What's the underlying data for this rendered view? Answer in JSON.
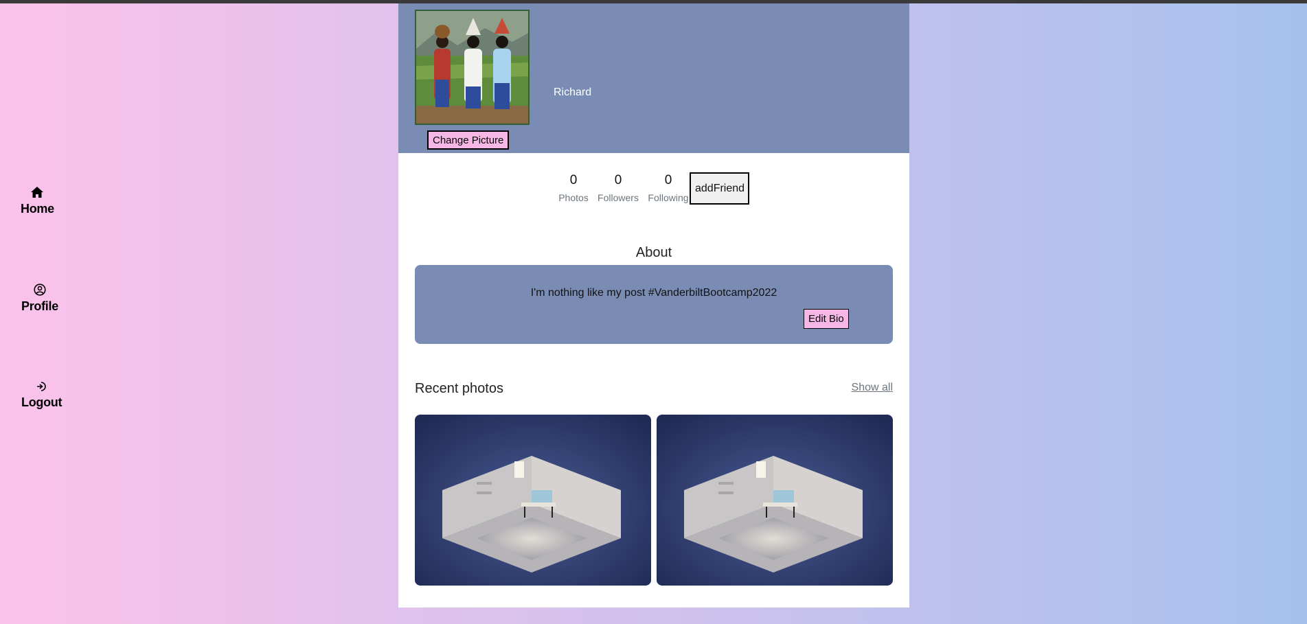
{
  "sidebar": {
    "items": [
      {
        "label": "Home",
        "icon": "home-icon"
      },
      {
        "label": "Profile",
        "icon": "user-circle-icon"
      },
      {
        "label": "Logout",
        "icon": "logout-icon"
      }
    ]
  },
  "profile": {
    "username": "Richard",
    "change_picture_label": "Change Picture",
    "avatar_icon": "profile-painting-image"
  },
  "stats": {
    "photos": {
      "value": "0",
      "label": "Photos"
    },
    "followers": {
      "value": "0",
      "label": "Followers"
    },
    "following": {
      "value": "0",
      "label": "Following"
    },
    "add_friend_label": "addFriend"
  },
  "about": {
    "title": "About",
    "bio": "I'm nothing like my post #VanderbiltBootcamp2022",
    "edit_bio_label": "Edit Bio"
  },
  "recent_photos": {
    "title": "Recent photos",
    "show_all_label": "Show all",
    "count": 2
  },
  "colors": {
    "header_bg": "#7a8cb4",
    "button_pink": "#f6b7e6",
    "gradient_start": "#fbc2eb",
    "gradient_end": "#a6c1ee"
  }
}
